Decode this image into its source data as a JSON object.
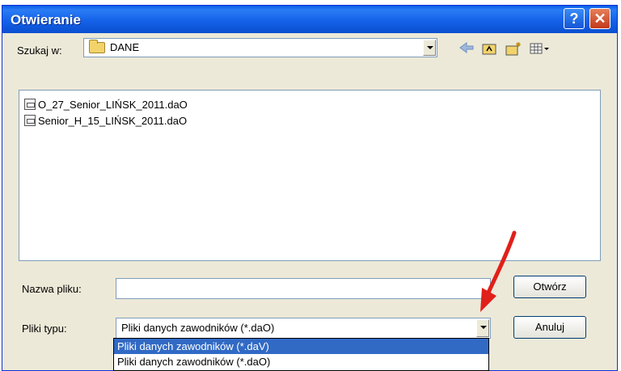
{
  "window": {
    "title": "Otwieranie",
    "help_glyph": "?",
    "close_glyph": "✕"
  },
  "lookin": {
    "label": "Szukaj w:",
    "value": "DANE"
  },
  "toolbar": {
    "back_icon": "back-arrow-icon",
    "up_icon": "up-folder-icon",
    "newfolder_icon": "new-folder-icon",
    "view_icon": "view-menu-icon"
  },
  "files": [
    {
      "name": "O_27_Senior_LIŃSK_2011.daO"
    },
    {
      "name": "Senior_H_15_LIŃSK_2011.daO"
    }
  ],
  "filename": {
    "label": "Nazwa pliku:",
    "value": ""
  },
  "filetype": {
    "label": "Pliki typu:",
    "value": "Pliki danych zawodników (*.daO)",
    "options": [
      "Pliki danych zawodników (*.daV)",
      "Pliki danych zawodników (*.daO)"
    ]
  },
  "buttons": {
    "open": "Otwórz",
    "cancel": "Anuluj"
  },
  "colors": {
    "annotation_arrow": "#e0201a",
    "selection": "#316ac5"
  }
}
